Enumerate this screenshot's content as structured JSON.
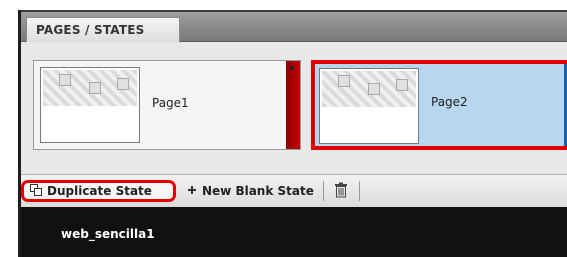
{
  "panel": {
    "tab_label": "PAGES / STATES"
  },
  "pages": [
    {
      "label": "Page1"
    },
    {
      "label": "Page2"
    }
  ],
  "toolbar": {
    "duplicate_label": "Duplicate State",
    "new_blank_label": "New Blank State",
    "duplicate_icon": "duplicate-icon",
    "new_icon": "plus-icon",
    "trash_icon": "trash-icon"
  },
  "status": {
    "site_name": "web_sencilla1"
  },
  "colors": {
    "highlight": "#e10000",
    "selected_page_bg": "#b9d6ef",
    "page1_accent": "#c40000",
    "page2_accent": "#1a5fa8",
    "status_bg": "#111111"
  }
}
